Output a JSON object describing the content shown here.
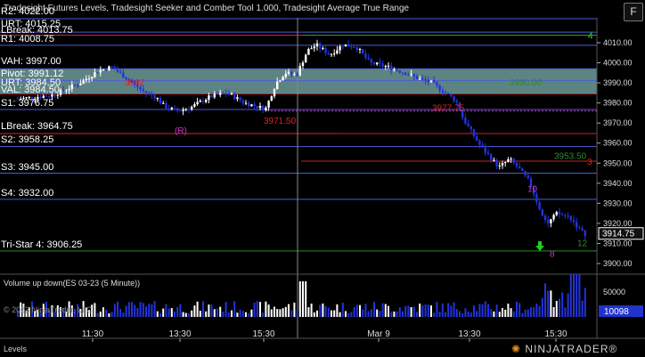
{
  "window": {
    "title": "Tradesight Futures Levels, Tradesight Seeker and Comber Tool 1.000, Tradesight Average True Range",
    "corner_button": "F",
    "footer_label": "Levels",
    "logo_text": "NINJATRADER",
    "logo_mark": "®"
  },
  "volume_panel": {
    "title": "Volume up down(ES 03-23 (5 Minute))",
    "copyright": "© 2023 NinjaTrader, LLC",
    "last_value": "10098",
    "axis_tick": "50000"
  },
  "price_axis": {
    "ticks": [
      "4010.00",
      "4000.00",
      "3990.00",
      "3980.00",
      "3970.00",
      "3960.00",
      "3950.00",
      "3940.00",
      "3930.00",
      "3920.00",
      "3910.00",
      "3900.00"
    ],
    "last_price": "3914.75",
    "tick_values": [
      4010,
      4000,
      3990,
      3980,
      3970,
      3960,
      3950,
      3940,
      3930,
      3920,
      3910,
      3900
    ]
  },
  "time_axis": {
    "labels": [
      "11:30",
      "13:30",
      "15:30",
      "Mar 9",
      "13:30",
      "15:30"
    ]
  },
  "levels": [
    {
      "label": "R2: 4022.00",
      "price": 4022.0,
      "color": "#4a5bd8"
    },
    {
      "label": "URT: 4015.25",
      "price": 4015.25,
      "color": "#4a5bd8"
    },
    {
      "label": "LBreak: 4013.75",
      "price": 4013.75,
      "color": "#d22"
    },
    {
      "label": "R1: 4008.75",
      "price": 4008.75,
      "color": "#4a5bd8"
    },
    {
      "label": "VAH: 3997.00",
      "price": 3997.0,
      "color": "#4a5bd8"
    },
    {
      "label": "Pivot: 3991.12",
      "price": 3991.12,
      "color": "#4a5bd8"
    },
    {
      "label": "URT: 3984.50",
      "price": 3984.5,
      "color": "#4a5bd8"
    },
    {
      "label": "VAL: 3984.50",
      "price": 3984.5,
      "color": "#d22"
    },
    {
      "label": "S1: 3976.75",
      "price": 3976.75,
      "color": "#4a5bd8"
    },
    {
      "label": "LBreak: 3964.75",
      "price": 3964.75,
      "color": "#d22"
    },
    {
      "label": "S2: 3958.25",
      "price": 3958.25,
      "color": "#4a5bd8"
    },
    {
      "label": "S3: 3945.00",
      "price": 3945.0,
      "color": "#4a5bd8"
    },
    {
      "label": "S4: 3932.00",
      "price": 3932.0,
      "color": "#4a5bd8"
    },
    {
      "label": "Tri-Star 4: 3906.25",
      "price": 3906.25,
      "color": "#2a8a2a"
    }
  ],
  "annotations": [
    {
      "text": "3971.50",
      "color": "#d22"
    },
    {
      "text": "3977.75",
      "color": "#d22"
    },
    {
      "text": "3953.50",
      "color": "#2a8a2a"
    },
    {
      "text": "3990.00",
      "color": "#2a8a2a"
    },
    {
      "text": "3992",
      "color": "#d22"
    },
    {
      "text": "(R)",
      "color": "#c3c"
    },
    {
      "text": "4",
      "color": "#2d2"
    },
    {
      "text": "3",
      "color": "#d22"
    },
    {
      "text": "8",
      "color": "#c3c"
    },
    {
      "text": "10",
      "color": "#c3c"
    },
    {
      "text": "12",
      "color": "#2a8a2a"
    }
  ],
  "colors": {
    "background": "#000000",
    "value_area": "#6f9a9a",
    "candle_up": "#ffffff",
    "candle_down": "#2233dd",
    "volume_up": "#ffffff",
    "volume_down": "#2233dd",
    "last_price_bg": "#111111",
    "volume_badge_bg": "#2233cc"
  },
  "icons": {
    "arrow_up": "green-up-arrow-icon"
  }
}
